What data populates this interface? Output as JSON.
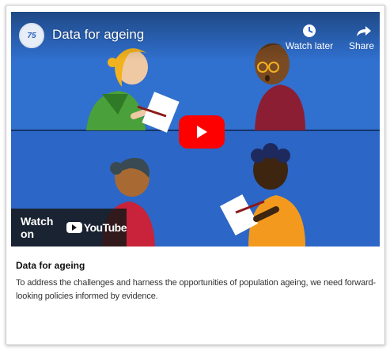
{
  "video": {
    "title": "Data for ageing",
    "channel_logo_text": "75",
    "watch_later_label": "Watch later",
    "share_label": "Share",
    "watch_on_label": "Watch on",
    "youtube_label": "YouTube",
    "icons": {
      "channel": "channel-logo-icon",
      "watch_later": "clock-icon",
      "share": "share-arrow-icon",
      "play": "play-icon"
    },
    "colors": {
      "play": "#ff0000",
      "background": "#2b65c4"
    }
  },
  "caption": {
    "title": "Data for ageing",
    "description": "To address the challenges and harness the opportunities of population ageing, we need forward-looking policies informed by evidence."
  }
}
